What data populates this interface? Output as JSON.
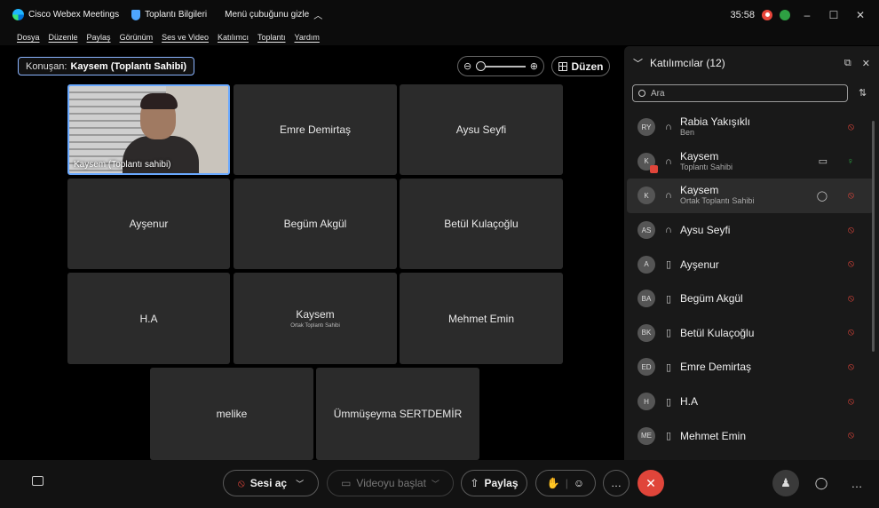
{
  "titlebar": {
    "app_name": "Cisco Webex Meetings",
    "meeting_info": "Toplantı Bilgileri",
    "hide_menu": "Menü çubuğunu gizle",
    "timer": "35:58"
  },
  "menu": [
    "Dosya",
    "Düzenle",
    "Paylaş",
    "Görünüm",
    "Ses ve Video",
    "Katılımcı",
    "Toplantı",
    "Yardım"
  ],
  "stage": {
    "speaker_prefix": "Konuşan:",
    "speaker_name": "Kaysem (Toplantı Sahibi)",
    "layout_label": "Düzen",
    "tiles": [
      {
        "name": "Kaysem (Toplantı sahibi)",
        "sub": "",
        "video": true
      },
      {
        "name": "Emre Demirtaş",
        "sub": ""
      },
      {
        "name": "Aysu Seyfi",
        "sub": ""
      },
      {
        "name": "Ayşenur",
        "sub": ""
      },
      {
        "name": "Begüm Akgül",
        "sub": ""
      },
      {
        "name": "Betül Kulaçoğlu",
        "sub": ""
      },
      {
        "name": "H.A",
        "sub": ""
      },
      {
        "name": "Kaysem",
        "sub": "Ortak Toplantı Sahibi"
      },
      {
        "name": "Mehmet Emin",
        "sub": ""
      },
      {
        "name": "melike",
        "sub": ""
      },
      {
        "name": "Ümmüşeyma SERTDEMİR",
        "sub": ""
      }
    ]
  },
  "panel": {
    "title": "Katılımcılar (12)",
    "search_placeholder": "Ara",
    "participants": [
      {
        "initials": "RY",
        "name": "Rabia Yakışıklı",
        "role": "Ben",
        "mic": "muted"
      },
      {
        "initials": "K",
        "name": "Kaysem",
        "role": "Toplantı Sahibi",
        "mic": "on",
        "camera": true
      },
      {
        "initials": "K",
        "name": "Kaysem",
        "role": "Ortak Toplantı Sahibi",
        "mic": "muted",
        "chat": true,
        "highlighted": true
      },
      {
        "initials": "AS",
        "name": "Aysu Seyfi",
        "role": "",
        "mic": "muted"
      },
      {
        "initials": "A",
        "name": "Ayşenur",
        "role": "",
        "mic": "muted"
      },
      {
        "initials": "BA",
        "name": "Begüm Akgül",
        "role": "",
        "mic": "muted"
      },
      {
        "initials": "BK",
        "name": "Betül Kulaçoğlu",
        "role": "",
        "mic": "muted"
      },
      {
        "initials": "ED",
        "name": "Emre Demirtaş",
        "role": "",
        "mic": "muted"
      },
      {
        "initials": "H",
        "name": "H.A",
        "role": "",
        "mic": "muted"
      },
      {
        "initials": "ME",
        "name": "Mehmet Emin",
        "role": "",
        "mic": "muted"
      }
    ]
  },
  "controls": {
    "unmute": "Sesi aç",
    "start_video": "Videoyu başlat",
    "share": "Paylaş"
  },
  "colors": {
    "accent": "#6aa9ff",
    "muted_red": "#e0453a",
    "active_green": "#2ea043"
  }
}
